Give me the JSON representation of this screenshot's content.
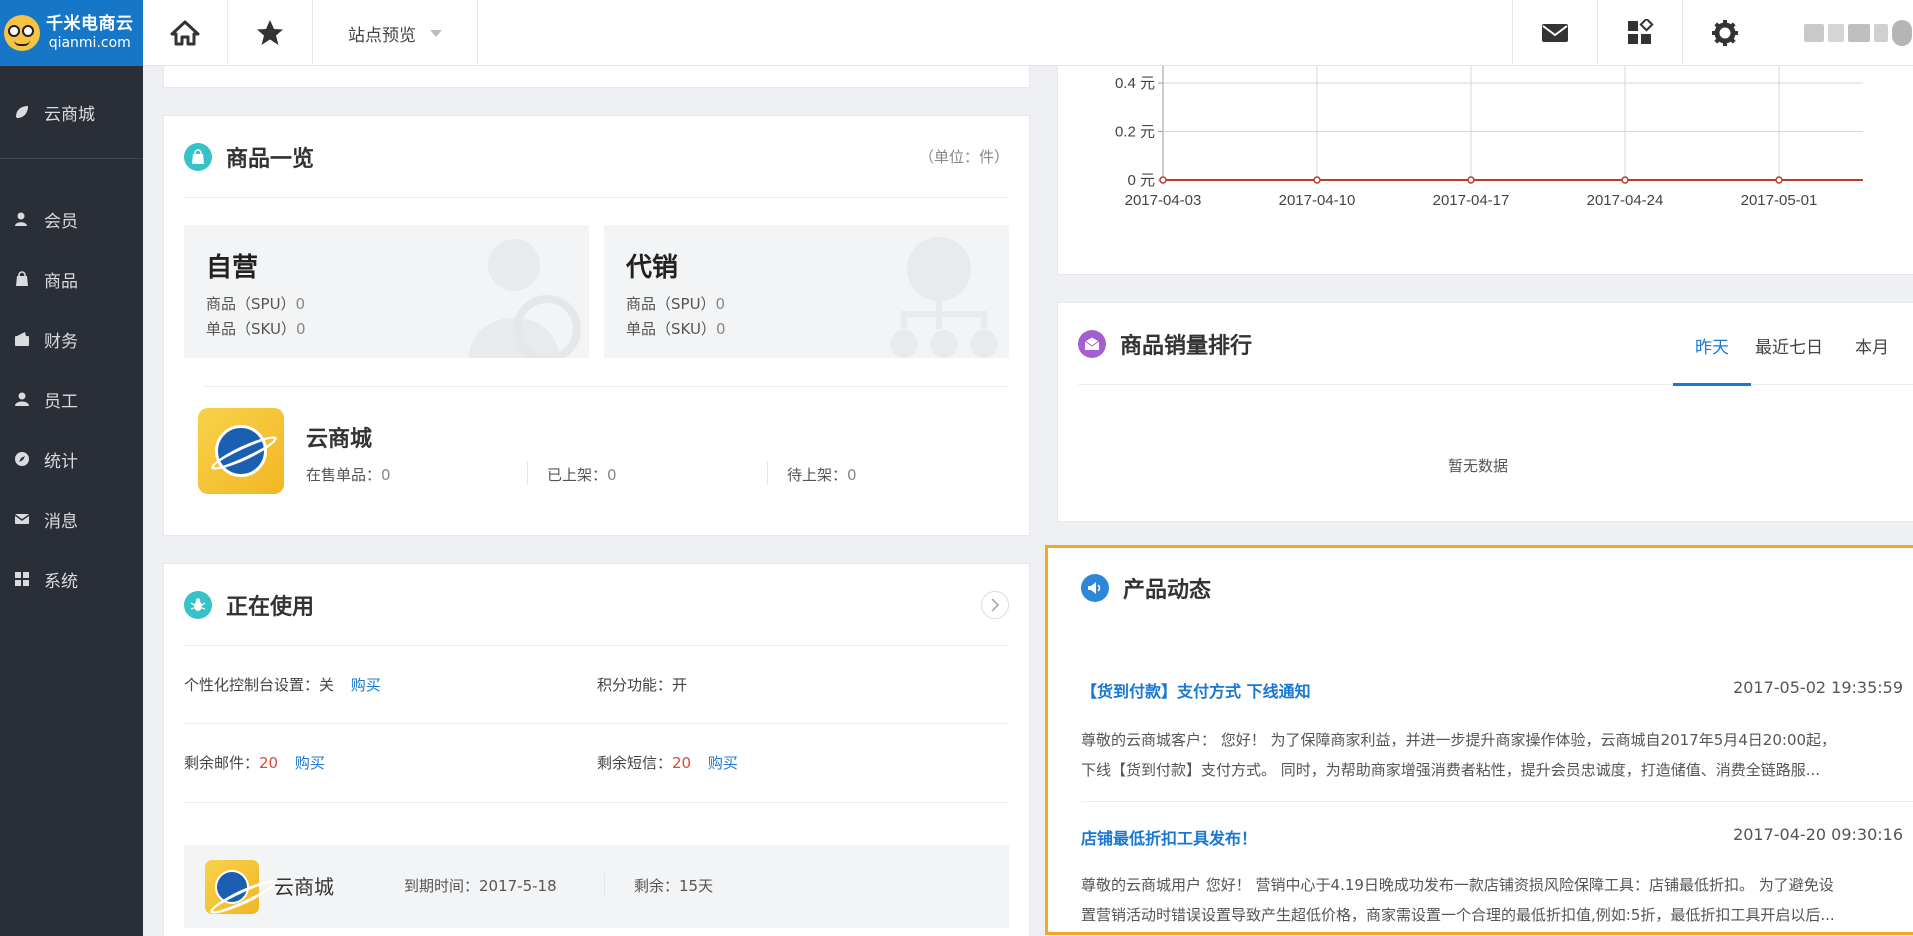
{
  "logo": {
    "cn": "千米电商云",
    "en": "qianmi.com"
  },
  "topbar": {
    "site_preview": "站点预览"
  },
  "sidebar": {
    "items": [
      {
        "label": "云商城"
      },
      {
        "label": "会员"
      },
      {
        "label": "商品"
      },
      {
        "label": "财务"
      },
      {
        "label": "员工"
      },
      {
        "label": "统计"
      },
      {
        "label": "消息"
      },
      {
        "label": "系统"
      }
    ]
  },
  "goods_overview": {
    "title": "商品一览",
    "unit_note": "（单位：件）",
    "self": {
      "title": "自营",
      "spu_label": "商品（SPU）",
      "spu_value": "0",
      "sku_label": "单品（SKU）",
      "sku_value": "0"
    },
    "agent": {
      "title": "代销",
      "spu_label": "商品（SPU）",
      "spu_value": "0",
      "sku_label": "单品（SKU）",
      "sku_value": "0"
    },
    "store": {
      "name": "云商城",
      "on_sale_label": "在售单品：",
      "on_sale": "0",
      "listed_label": "已上架：",
      "listed": "0",
      "pending_label": "待上架：",
      "pending": "0"
    }
  },
  "in_use": {
    "title": "正在使用",
    "console_label": "个性化控制台设置：关",
    "points_label": "积分功能：开",
    "mail_label": "剩余邮件：",
    "mail_value": "20",
    "sms_label": "剩余短信：",
    "sms_value": "20",
    "buy": "购买",
    "store_name": "云商城",
    "expire_label": "到期时间：2017-5-18",
    "remain_label": "剩余：15天"
  },
  "chart_data": {
    "type": "line",
    "x": [
      "2017-04-03",
      "2017-04-10",
      "2017-04-17",
      "2017-04-24",
      "2017-05-01"
    ],
    "y_ticks": [
      "0.4 元",
      "0.2 元",
      "0 元"
    ],
    "series": [
      {
        "values": [
          0,
          0,
          0,
          0,
          0
        ]
      }
    ],
    "ylim": [
      0,
      0.4
    ],
    "line_color": "#c0392b"
  },
  "sales_rank": {
    "title": "商品销量排行",
    "tabs": [
      "昨天",
      "最近七日",
      "本月"
    ],
    "empty": "暂无数据"
  },
  "product_news": {
    "title": "产品动态",
    "items": [
      {
        "title": "【货到付款】支付方式 下线通知",
        "time": "2017-05-02 19:35:59",
        "line1": "尊敬的云商城客户： 您好！ 为了保障商家利益，并进一步提升商家操作体验，云商城自2017年5月4日20:00起，",
        "line2": "下线【货到付款】支付方式。 同时，为帮助商家增强消费者粘性，提升会员忠诚度，打造储值、消费全链路服..."
      },
      {
        "title": "店铺最低折扣工具发布！",
        "time": "2017-04-20 09:30:16",
        "line1": "尊敬的云商城用户 您好！ 营销中心于4.19日晚成功发布一款店铺资损风险保障工具：店铺最低折扣。 为了避免设",
        "line2": "置营销活动时错误设置导致产生超低价格，商家需设置一个合理的最低折扣值,例如:5折，最低折扣工具开启以后..."
      }
    ]
  },
  "colors": {
    "accent": "#1a78d2",
    "highlight_border": "#f5a623",
    "sidebar_bg": "#2a2e36"
  }
}
